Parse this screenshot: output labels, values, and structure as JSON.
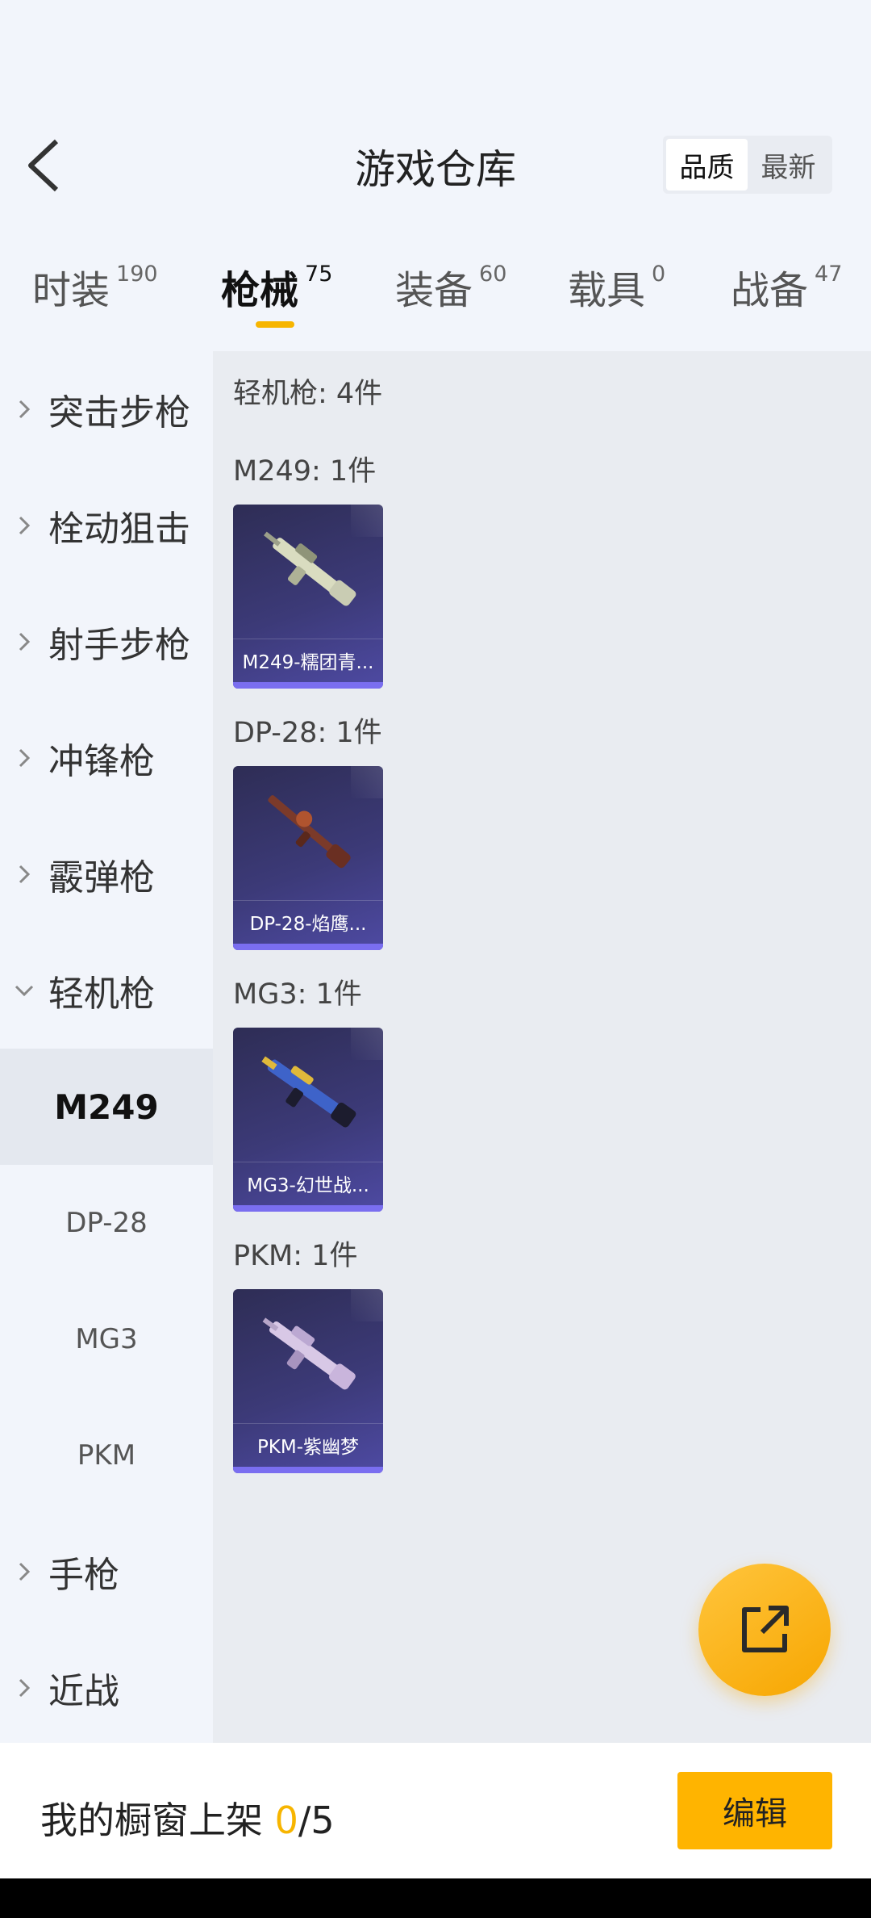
{
  "header": {
    "title": "游戏仓库",
    "sort": [
      "品质",
      "最新"
    ]
  },
  "tabs": [
    {
      "label": "时装",
      "count": "190"
    },
    {
      "label": "枪械",
      "count": "75"
    },
    {
      "label": "装备",
      "count": "60"
    },
    {
      "label": "载具",
      "count": "0"
    },
    {
      "label": "战备",
      "count": "47"
    }
  ],
  "sidebar": {
    "categories": [
      "突击步枪",
      "栓动狙击",
      "射手步枪",
      "冲锋枪",
      "霰弹枪",
      "轻机枪",
      "手枪",
      "近战"
    ],
    "sub_items": [
      "M249",
      "DP-28",
      "MG3",
      "PKM"
    ]
  },
  "main": {
    "section_title": "轻机枪: 4件",
    "groups": [
      {
        "title": "M249: 1件",
        "item": "M249-糯团青..."
      },
      {
        "title": "DP-28: 1件",
        "item": "DP-28-焰鹰..."
      },
      {
        "title": "MG3: 1件",
        "item": "MG3-幻世战..."
      },
      {
        "title": "PKM: 1件",
        "item": "PKM-紫幽梦"
      }
    ]
  },
  "footer": {
    "showcase_label": "我的橱窗上架 ",
    "showcase_count": "0",
    "showcase_total": "/5",
    "edit_label": "编辑"
  },
  "colors": {
    "accent": "#f7b500",
    "card_bg": "#3c3a78",
    "card_bar": "#7a6ef0"
  }
}
